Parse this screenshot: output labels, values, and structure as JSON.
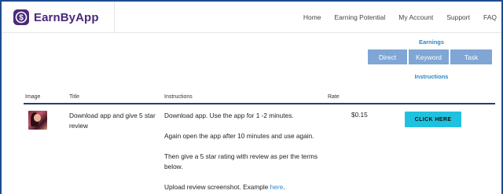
{
  "header": {
    "logo_text": "EarnByApp",
    "nav": [
      "Home",
      "Earning Potential",
      "My Account",
      "Support",
      "FAQ"
    ]
  },
  "earnings": {
    "title": "Earnings",
    "filters": [
      "Direct",
      "Keyword",
      "Task"
    ],
    "instructions_link": "Instructions"
  },
  "table": {
    "columns": [
      "Image",
      "Title",
      "Instructions",
      "Rate"
    ],
    "rows": [
      {
        "title": "Download app and give 5 star review",
        "instructions": [
          "Download app. Use the app for 1 -2 minutes.",
          "Again open the app after 10 minutes and use again.",
          "Then give a 5 star rating with review as per the terms below."
        ],
        "upload_prefix": "Upload review screenshot. Example ",
        "upload_link": "here",
        "upload_suffix": ".",
        "rate": "$0.15",
        "action": "CLICK HERE"
      }
    ]
  },
  "colors": {
    "frame": "#1d4b8f",
    "brand": "#4a2a7a",
    "filter_button": "#7fa6d4",
    "link": "#2d85c8",
    "cta": "#1fc2de"
  }
}
